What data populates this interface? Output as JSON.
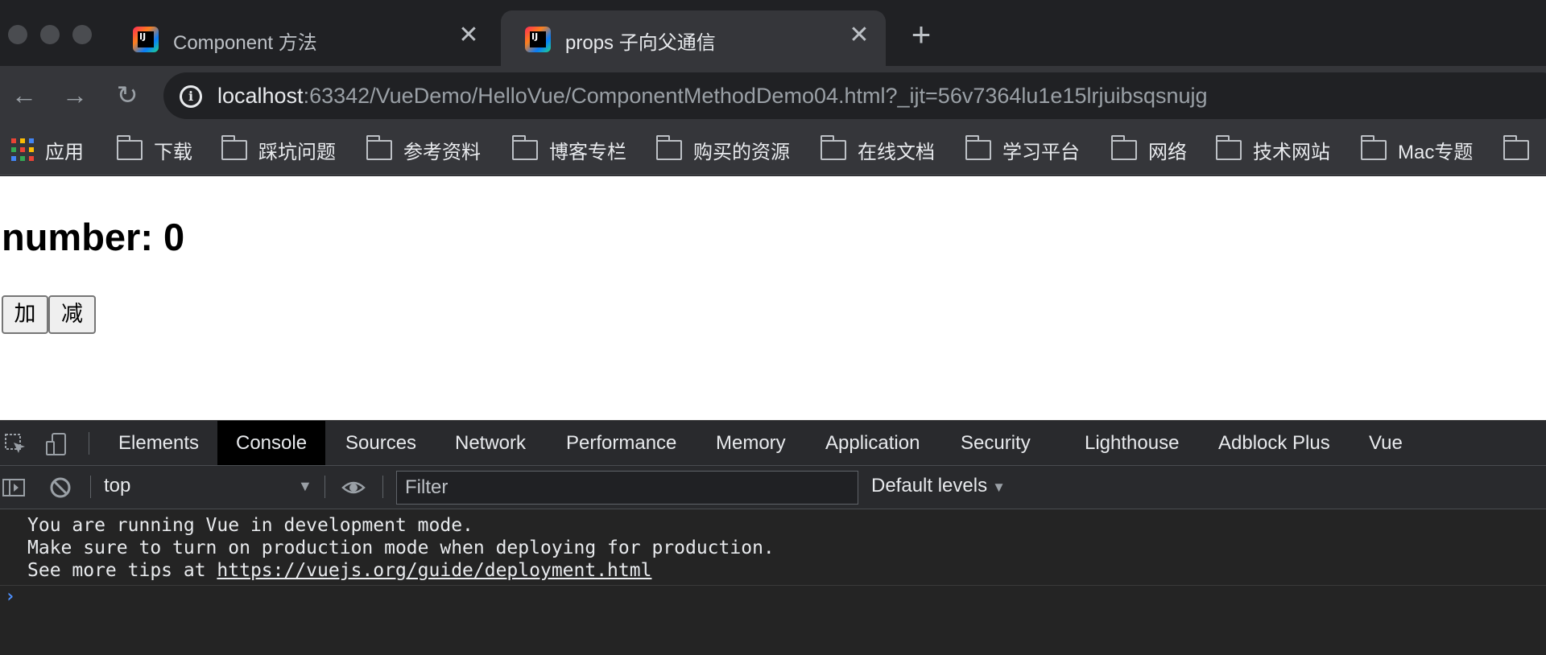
{
  "browser": {
    "tabs": [
      {
        "title": "Component 方法",
        "active": false
      },
      {
        "title": "props 子向父通信",
        "active": true
      }
    ],
    "new_tab_label": "+",
    "close_glyph": "✕",
    "url_host": "localhost",
    "url_rest": ":63342/VueDemo/HelloVue/ComponentMethodDemo04.html?_ijt=56v7364lu1e15lrjuibsqsnujg",
    "bookmarks": [
      "应用",
      "下载",
      "踩坑问题",
      "参考资料",
      "博客专栏",
      "购买的资源",
      "在线文档",
      "学习平台",
      "网络",
      "技术网站",
      "Mac专题"
    ]
  },
  "page": {
    "number_text": "number: 0",
    "add_label": "加",
    "sub_label": "减"
  },
  "devtools": {
    "tabs": [
      "Elements",
      "Console",
      "Sources",
      "Network",
      "Performance",
      "Memory",
      "Application",
      "Security",
      "Lighthouse",
      "Adblock Plus",
      "Vue"
    ],
    "active_tab": "Console",
    "context": "top",
    "filter_placeholder": "Filter",
    "levels": "Default levels",
    "console_lines": [
      "You are running Vue in development mode.",
      "Make sure to turn on production mode when deploying for production.",
      "See more tips at "
    ],
    "console_link": "https://vuejs.org/guide/deployment.html",
    "prompt": "›"
  },
  "colors": {
    "titlebar_bg": "#202124",
    "toolbar_bg": "#35363a",
    "devtools_bg": "#242424",
    "prompt_blue": "#4d90fe"
  }
}
